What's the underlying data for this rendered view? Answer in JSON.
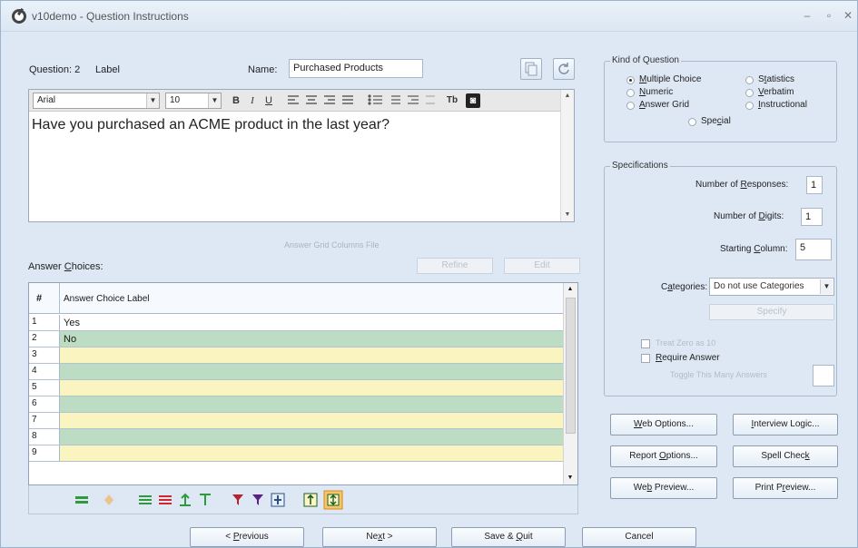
{
  "window": {
    "title": "v10demo - Question Instructions"
  },
  "header": {
    "question_label": "Question: 2",
    "label_label": "Label",
    "name_label": "Name:",
    "name_value": "Purchased Products"
  },
  "editor": {
    "font": "Arial",
    "size": "10",
    "text": "Have you purchased an ACME product in the last year?"
  },
  "answers": {
    "grid_columns_file_label": "Answer Grid Columns File",
    "choices_label": "Answer Choices:",
    "refine_label": "Refine",
    "edit_label": "Edit",
    "col_num": "#",
    "col_label": "Answer Choice Label",
    "rows": [
      {
        "n": "1",
        "label": "Yes"
      },
      {
        "n": "2",
        "label": "No"
      },
      {
        "n": "3",
        "label": ""
      },
      {
        "n": "4",
        "label": ""
      },
      {
        "n": "5",
        "label": ""
      },
      {
        "n": "6",
        "label": ""
      },
      {
        "n": "7",
        "label": ""
      },
      {
        "n": "8",
        "label": ""
      },
      {
        "n": "9",
        "label": ""
      }
    ]
  },
  "kind": {
    "title": "Kind of Question",
    "multiple_choice": "Multiple Choice",
    "numeric": "Numeric",
    "answer_grid": "Answer Grid",
    "statistics": "Statistics",
    "verbatim": "Verbatim",
    "instructional": "Instructional",
    "special": "Special"
  },
  "specs": {
    "title": "Specifications",
    "num_responses_label": "Number of Responses:",
    "num_responses_value": "1",
    "num_digits_label": "Number of Digits:",
    "num_digits_value": "1",
    "start_col_label": "Starting Column:",
    "start_col_value": "5",
    "categories_label": "Categories:",
    "categories_value": "Do not use Categories",
    "specify_label": "Specify",
    "fixed_zero_label": "Treat Zero as 10",
    "require_answer_label": "Require Answer",
    "toggle_many_label": "Toggle This Many Answers"
  },
  "buttons": {
    "web_options": "Web Options...",
    "interview_logic": "Interview Logic...",
    "report_options": "Report Options...",
    "spell_check": "Spell Check",
    "web_preview": "Web Preview...",
    "print_preview": "Print Preview..."
  },
  "footer": {
    "previous": "< Previous",
    "next": "Next >",
    "save_quit": "Save & Quit",
    "cancel": "Cancel"
  },
  "colors": {
    "row_green": "#bcdcc3",
    "row_yellow": "#faf5c0",
    "row_white": "#ffffff"
  }
}
